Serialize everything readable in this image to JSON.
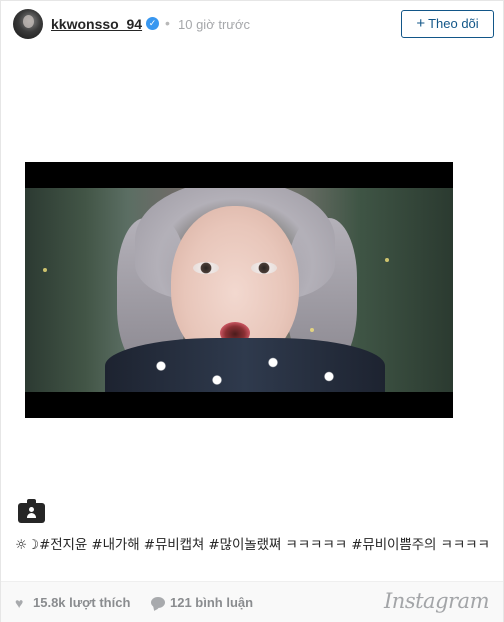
{
  "header": {
    "username": "kkwonsso_94",
    "verified_icon": "verified-badge-icon",
    "separator": "•",
    "timestamp": "10 giờ trước",
    "follow_label": "Theo dõi",
    "follow_plus": "+"
  },
  "media": {
    "type": "video",
    "camera_icon": "camera-video-icon"
  },
  "caption": {
    "text": "☼☽#전지윤 #내가해 #뮤비캡쳐 #많이놀랬쪄 ㅋㅋㅋㅋㅋ #뮤비이쁨주의 ㅋㅋㅋㅋ"
  },
  "footer": {
    "likes": "15.8k lượt thích",
    "comments": "121 bình luận",
    "logo_text": "Instagram",
    "heart_icon": "heart-icon",
    "comment_icon": "comment-bubble-icon"
  },
  "colors": {
    "link_blue": "#125688",
    "verified_blue": "#3897f0",
    "muted_text": "#a5a7aa"
  }
}
